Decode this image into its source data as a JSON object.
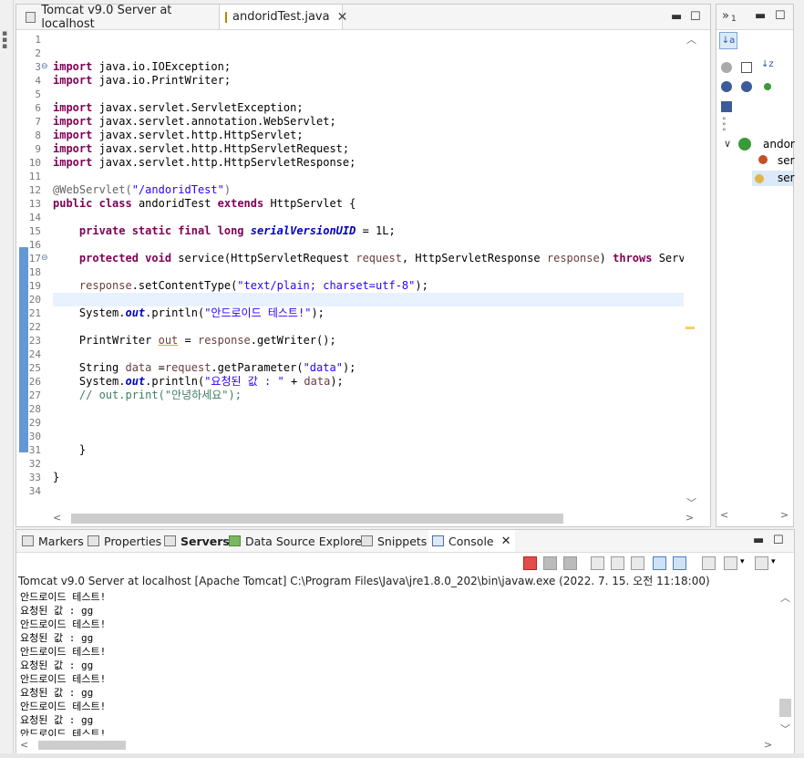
{
  "editor": {
    "tabs": [
      {
        "label": "Tomcat v9.0 Server at localhost",
        "active": false
      },
      {
        "label": "andoridTest.java",
        "active": true
      }
    ],
    "line_numbers": [
      "1",
      "2",
      "3",
      "4",
      "5",
      "6",
      "7",
      "8",
      "9",
      "10",
      "11",
      "12",
      "13",
      "14",
      "15",
      "16",
      "17",
      "18",
      "19",
      "20",
      "21",
      "22",
      "23",
      "24",
      "25",
      "26",
      "27",
      "28",
      "29",
      "30",
      "31",
      "32",
      "33",
      "34"
    ],
    "fold_markers": {
      "3": "⊖",
      "17": "⊖"
    },
    "code": {
      "l3_kw": "import",
      "l3_rest": " java.io.IOException;",
      "l4_kw": "import",
      "l4_rest": " java.io.PrintWriter;",
      "l6_kw": "import",
      "l6_rest": " javax.servlet.ServletException;",
      "l7_kw": "import",
      "l7_rest": " javax.servlet.annotation.WebServlet;",
      "l8_kw": "import",
      "l8_rest": " javax.servlet.http.HttpServlet;",
      "l9_kw": "import",
      "l9_rest": " javax.servlet.http.HttpServletRequest;",
      "l10_kw": "import",
      "l10_rest": " javax.servlet.http.HttpServletResponse;",
      "l12_ann": "@WebServlet(",
      "l12_str": "\"/andoridTest\"",
      "l12_end": ")",
      "l13_kw1": "public",
      "l13_kw2": "class",
      "l13_mid": " andoridTest ",
      "l13_kw3": "extends",
      "l13_rest": " HttpServlet {",
      "l15_kw": "    private static final long",
      "l15_fld": "serialVersionUID",
      "l15_rest": " = 1L;",
      "l17_kw": "    protected void",
      "l17_a": " service(HttpServletRequest ",
      "l17_p1": "request",
      "l17_b": ", HttpServletResponse ",
      "l17_p2": "response",
      "l17_c": ") ",
      "l17_kw2": "throws",
      "l17_d": " Servlet",
      "l19_p": "    response",
      "l19_a": ".setContentType(",
      "l19_str": "\"text/plain; charset=utf-8\"",
      "l19_b": ");",
      "l21_a": "    System.",
      "l21_out": "out",
      "l21_b": ".println(",
      "l21_str": "\"안드로이드 테스트!\"",
      "l21_c": ");",
      "l23_a": "    PrintWriter ",
      "l23_v": "out",
      "l23_b": " = ",
      "l23_p": "response",
      "l23_c": ".getWriter();",
      "l25_a": "    String ",
      "l25_v": "data",
      "l25_b": " =",
      "l25_p": "request",
      "l25_c": ".getParameter(",
      "l25_str": "\"data\"",
      "l25_d": ");",
      "l26_a": "    System.",
      "l26_out": "out",
      "l26_b": ".println(",
      "l26_str": "\"요청된 값 : \"",
      "l26_c": " + ",
      "l26_v": "data",
      "l26_d": ");",
      "l27_cmt": "    // out.print(\"안녕하세요\");",
      "l31": "    }",
      "l33": "}"
    }
  },
  "outline": {
    "items": [
      {
        "label": "andor"
      },
      {
        "label": "ser"
      },
      {
        "label": "ser"
      }
    ],
    "top_buttons": [
      "»",
      "1"
    ]
  },
  "bottom": {
    "tabs": [
      {
        "label": "Markers"
      },
      {
        "label": "Properties"
      },
      {
        "label": "Servers"
      },
      {
        "label": "Data Source Explorer"
      },
      {
        "label": "Snippets"
      },
      {
        "label": "Console"
      }
    ],
    "launch_line": "Tomcat v9.0 Server at localhost [Apache Tomcat] C:\\Program Files\\Java\\jre1.8.0_202\\bin\\javaw.exe  (2022. 7. 15. 오전 11:18:00)",
    "console_lines": [
      "안드로이드 테스트!",
      "요청된 값 : gg",
      "안드로이드 테스트!",
      "요청된 값 : gg",
      "안드로이드 테스트!",
      "요청된 값 : gg",
      "안드로이드 테스트!",
      "요청된 값 : gg",
      "안드로이드 테스트!",
      "요청된 값 : gg",
      "안드로이드 테스트!"
    ]
  },
  "colors": {
    "keyword": "#7f0055",
    "string": "#2a00ff",
    "comment": "#3f7f5f",
    "field": "#0000c0",
    "current_line": "#e8f2fe",
    "change_bar": "#2f77c4"
  }
}
